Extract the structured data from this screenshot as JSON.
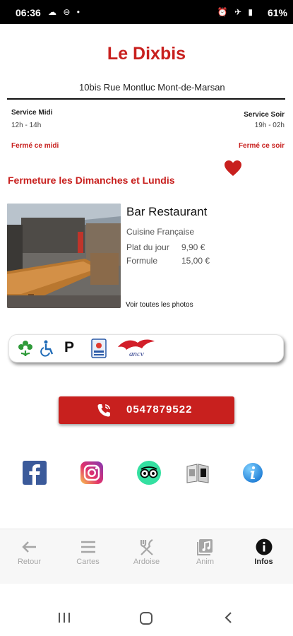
{
  "status_bar": {
    "time": "06:36",
    "left_icons": "☁ ⊖ •",
    "right_icons": "⏰ ✈ ▮",
    "battery": "61%"
  },
  "header": {
    "title": "Le Dixbis",
    "address": "10bis Rue Montluc Mont-de-Marsan"
  },
  "services": {
    "midi": {
      "label": "Service Midi",
      "hours": "12h - 14h",
      "status": "Fermé ce midi"
    },
    "soir": {
      "label": "Service Soir",
      "hours": "19h - 02h",
      "status": "Fermé ce soir"
    }
  },
  "closure_notice": "Fermeture les Dimanches et Lundis",
  "restaurant": {
    "name": "Bar Restaurant",
    "cuisine": "Cuisine Française",
    "menu": [
      {
        "label": "Plat du jour",
        "price": "9,90 €"
      },
      {
        "label": "Formule",
        "price": "15,00 €"
      }
    ],
    "photos_link": "Voir toutes les photos"
  },
  "amenities": [
    "tourism-flower-icon",
    "wheelchair-icon",
    "parking-icon",
    "payment-card-icon",
    "ancv-logo"
  ],
  "ancv_text": "ancv",
  "parking_text": "P",
  "phone": {
    "number": "0547879522"
  },
  "social": [
    "facebook-icon",
    "instagram-icon",
    "tripadvisor-icon",
    "guide-book-icon",
    "info-icon"
  ],
  "bottom_nav": [
    {
      "label": "Retour",
      "icon": "back-arrow-icon",
      "active": false
    },
    {
      "label": "Cartes",
      "icon": "menu-lines-icon",
      "active": false
    },
    {
      "label": "Ardoise",
      "icon": "fork-knife-icon",
      "active": false
    },
    {
      "label": "Anim",
      "icon": "music-note-icon",
      "active": false
    },
    {
      "label": "Infos",
      "icon": "info-icon",
      "active": true
    }
  ],
  "colors": {
    "brand_red": "#c8201e",
    "nav_inactive": "#a6a6a6",
    "nav_active": "#222222"
  }
}
